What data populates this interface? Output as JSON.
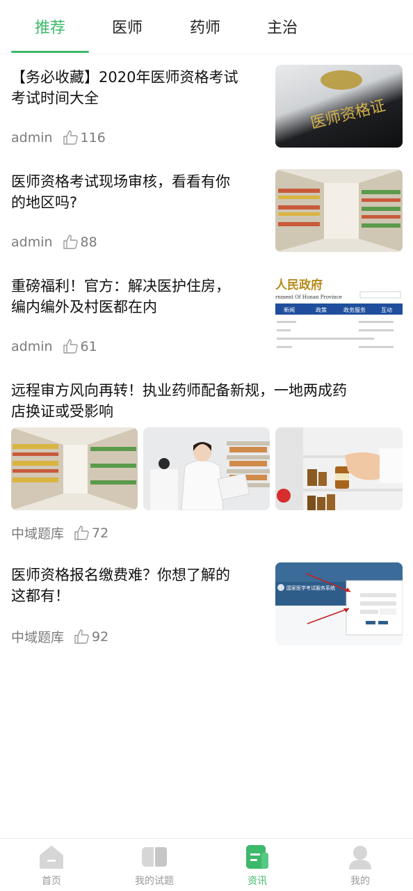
{
  "tabs": [
    {
      "label": "推荐"
    },
    {
      "label": "医师"
    },
    {
      "label": "药师"
    },
    {
      "label": "主治"
    }
  ],
  "active_tab": "推荐",
  "accent_color": "#3cb96a",
  "articles": [
    {
      "title_line1": "【务必收藏】2020年医师资格考试",
      "title_line2": "考试时间大全",
      "author": "admin",
      "likes": "116",
      "images": [
        "doctor-qualification-certificate"
      ]
    },
    {
      "title_line1": "医师资格考试现场审核，看看有你",
      "title_line2": "的地区吗?",
      "author": "admin",
      "likes": "88",
      "images": [
        "pharmacy-shelves"
      ]
    },
    {
      "title_line1": "重磅福利！官方：解决医护住房，",
      "title_line2": "编内编外及村医都在内",
      "author": "admin",
      "likes": "61",
      "images": [
        "government-website-screenshot"
      ]
    },
    {
      "title_line1": "远程审方风向再转！执业药师配备新规，一地两成药",
      "title_line2": "店换证或受影响",
      "author": "中域题库",
      "likes": "72",
      "images": [
        "pharmacy-aisle",
        "pharmacists-smiling",
        "hand-holding-medicine-bottle"
      ]
    },
    {
      "title_line1": "医师资格报名缴费难？你想了解的",
      "title_line2": "这都有！",
      "author": "中域题库",
      "likes": "92",
      "images": [
        "exam-registration-website"
      ]
    }
  ],
  "image_text": {
    "certificate": "医师资格证",
    "gov_header": "人民政府",
    "gov_subheader": "rnment Of Hunan Province",
    "gov_nav": [
      "新闻",
      "政策",
      "政务服务",
      "互动"
    ],
    "reg_site_title": "国家医学考试服务系统"
  },
  "bottom_nav": [
    {
      "label": "首页",
      "icon": "home-icon"
    },
    {
      "label": "我的试题",
      "icon": "exam-icon"
    },
    {
      "label": "资讯",
      "icon": "news-icon"
    },
    {
      "label": "我的",
      "icon": "profile-icon"
    }
  ],
  "active_nav": "资讯"
}
